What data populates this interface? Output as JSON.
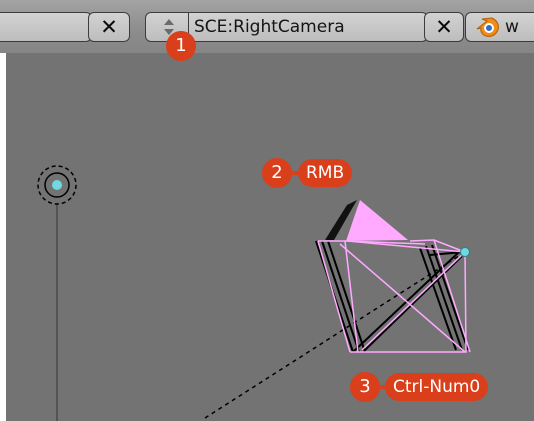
{
  "header": {
    "left_close_label": "✕",
    "scene_browse_icon": "up-down-arrows-icon",
    "scene_name": "SCE:RightCamera",
    "scene_close_label": "✕",
    "screen_logo_icon": "blender-logo-icon",
    "screen_name": "w"
  },
  "viewport": {
    "lamp_icon": "lamp-icon",
    "camera_icon": "camera-object-icon"
  },
  "callouts": [
    {
      "number": "1",
      "text": ""
    },
    {
      "number": "2",
      "text": "RMB"
    },
    {
      "number": "3",
      "text": "Ctrl-Num0"
    }
  ],
  "colors": {
    "header_background": "#8b8b8b",
    "viewport_background": "#737373",
    "selected_camera_wire": "#ffaaff",
    "active_vertex": "#6fd8e0",
    "callout": "#d93f1a"
  }
}
